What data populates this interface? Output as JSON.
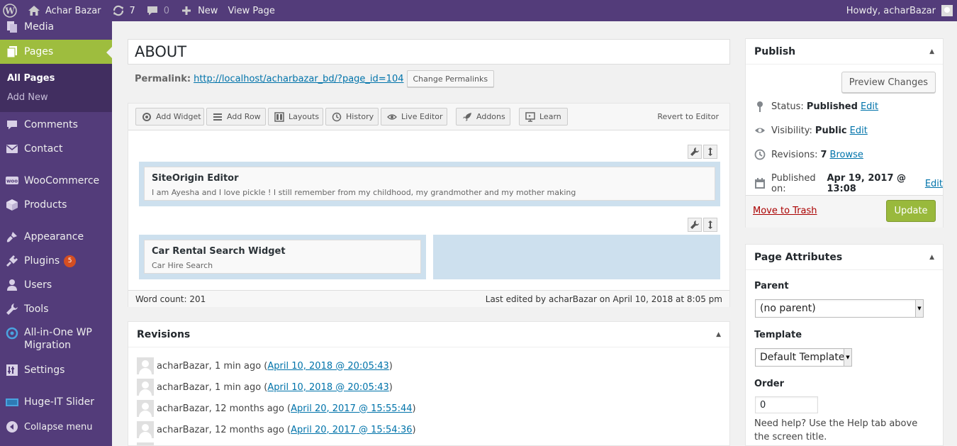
{
  "admin_bar": {
    "site_name": "Achar Bazar",
    "updates_count": "7",
    "comments_count": "0",
    "new_label": "New",
    "view_page_label": "View Page",
    "howdy": "Howdy, acharBazar"
  },
  "sidebar": {
    "media": "Media",
    "pages": "Pages",
    "all_pages": "All Pages",
    "add_new": "Add New",
    "comments": "Comments",
    "contact": "Contact",
    "woocommerce": "WooCommerce",
    "products": "Products",
    "appearance": "Appearance",
    "plugins": "Plugins",
    "plugins_badge": "5",
    "users": "Users",
    "tools": "Tools",
    "aio_line1": "All-in-One WP",
    "aio_line2": "Migration",
    "settings": "Settings",
    "hugeit": "Huge-IT Slider",
    "collapse": "Collapse menu"
  },
  "editor": {
    "title": "ABOUT",
    "permalink_label": "Permalink:",
    "permalink_url": "http://localhost/acharbazar_bd/?page_id=104",
    "change_permalinks": "Change Permalinks"
  },
  "builder": {
    "toolbar": {
      "add_widget": "Add Widget",
      "add_row": "Add Row",
      "layouts": "Layouts",
      "history": "History",
      "live_editor": "Live Editor",
      "addons": "Addons",
      "learn": "Learn",
      "revert": "Revert to Editor"
    },
    "widget1_title": "SiteOrigin Editor",
    "widget1_desc": "I am Ayesha and I love pickle ! I still remember from my childhood, my grandmother and my mother making",
    "widget2_title": "Car Rental Search Widget",
    "widget2_desc": "Car Hire Search",
    "word_count": "Word count: 201",
    "last_edited": "Last edited by acharBazar on April 10, 2018 at 8:05 pm"
  },
  "revisions": {
    "title": "Revisions",
    "items": [
      {
        "author": "acharBazar, 1 min ago (",
        "link": "April 10, 2018 @ 20:05:43",
        "close": ")"
      },
      {
        "author": "acharBazar, 1 min ago (",
        "link": "April 10, 2018 @ 20:05:43",
        "close": ")"
      },
      {
        "author": "acharBazar, 12 months ago (",
        "link": "April 20, 2017 @ 15:55:44",
        "close": ")"
      },
      {
        "author": "acharBazar, 12 months ago (",
        "link": "April 20, 2017 @ 15:54:36",
        "close": ")"
      }
    ]
  },
  "publish": {
    "title": "Publish",
    "preview": "Preview Changes",
    "status_label": "Status:",
    "status_value": "Published",
    "visibility_label": "Visibility:",
    "visibility_value": "Public",
    "revisions_label": "Revisions:",
    "revisions_value": "7",
    "browse": "Browse",
    "published_on_label": "Published on:",
    "published_on_value": "Apr 19, 2017 @ 13:08",
    "edit": "Edit",
    "trash": "Move to Trash",
    "update": "Update"
  },
  "page_attributes": {
    "title": "Page Attributes",
    "parent_label": "Parent",
    "parent_value": "(no parent)",
    "template_label": "Template",
    "template_value": "Default Template",
    "order_label": "Order",
    "order_value": "0",
    "help": "Need help? Use the Help tab above the screen title."
  },
  "colors": {
    "admin_purple": "#533c7a",
    "accent_green": "#9ebd3e",
    "link_blue": "#0073aa"
  }
}
